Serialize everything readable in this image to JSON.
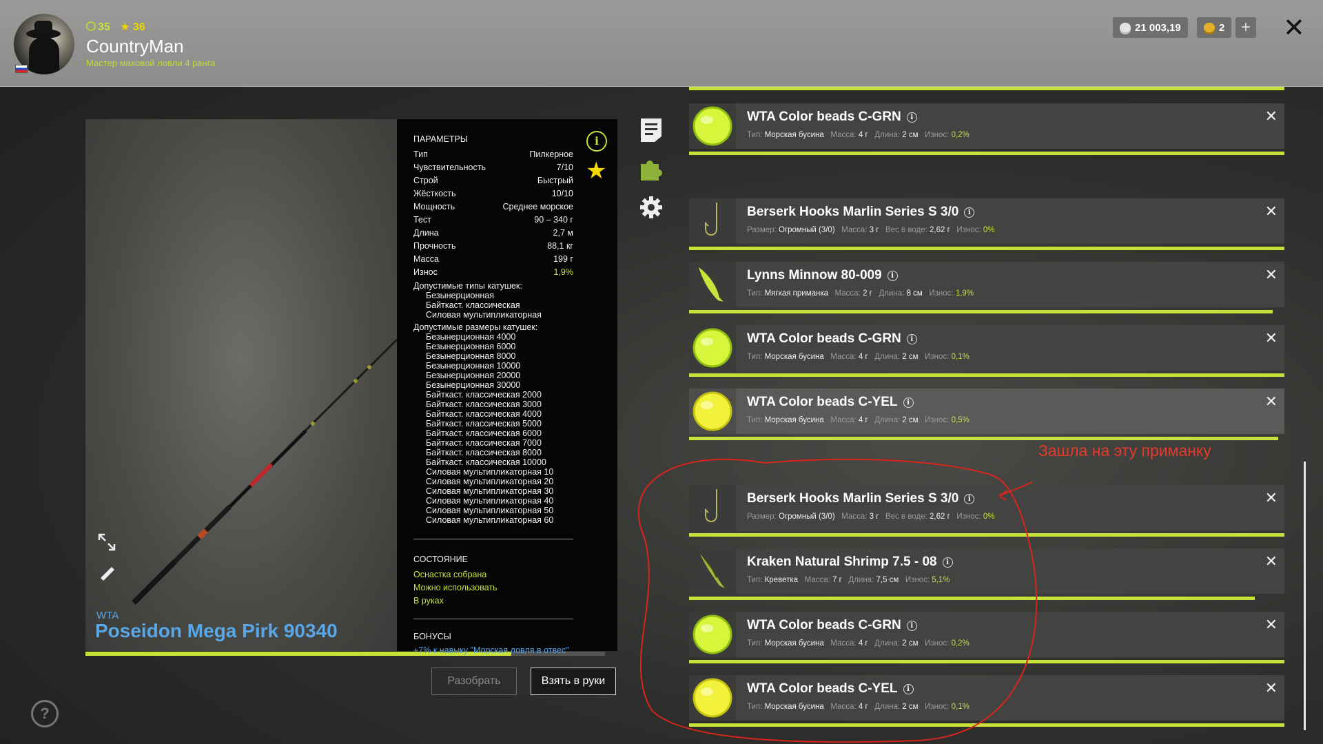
{
  "header": {
    "level": "35",
    "stars": "36",
    "username": "CountryMan",
    "rank": "Мастер маховой ловли 4 ранга",
    "silver": "21 003,19",
    "gold": "2",
    "plus": "+",
    "close": "✕"
  },
  "rod": {
    "brand": "WTA",
    "name": "Poseidon Mega Pirk 90340",
    "wear_progress": 0.82
  },
  "params": {
    "title": "ПАРАМЕТРЫ",
    "rows": [
      {
        "label": "Тип",
        "value": "Пилкерное"
      },
      {
        "label": "Чувствительность",
        "value": "7/10"
      },
      {
        "label": "Строй",
        "value": "Быстрый"
      },
      {
        "label": "Жёсткость",
        "value": "10/10"
      },
      {
        "label": "Мощность",
        "value": "Среднее морское"
      },
      {
        "label": "Тест",
        "value": "90 – 340 г"
      },
      {
        "label": "Длина",
        "value": "2,7 м"
      },
      {
        "label": "Прочность",
        "value": "88,1 кг"
      },
      {
        "label": "Масса",
        "value": "199 г"
      },
      {
        "label": "Износ",
        "value": "1,9%"
      }
    ],
    "reel_types_label": "Допустимые типы катушек:",
    "reel_types": [
      "Безынерционная",
      "Байткаст. классическая",
      "Силовая мультипликаторная"
    ],
    "reel_sizes_label": "Допустимые размеры катушек:",
    "reel_sizes": [
      "Безынерционная 4000",
      "Безынерционная 6000",
      "Безынерционная 8000",
      "Безынерционная 10000",
      "Безынерционная 20000",
      "Безынерционная 30000",
      "Байткаст. классическая 2000",
      "Байткаст. классическая 3000",
      "Байткаст. классическая 4000",
      "Байткаст. классическая 5000",
      "Байткаст. классическая 6000",
      "Байткаст. классическая 7000",
      "Байткаст. классическая 8000",
      "Байткаст. классическая 10000",
      "Силовая мультипликаторная 10",
      "Силовая мультипликаторная 20",
      "Силовая мультипликаторная 30",
      "Силовая мультипликаторная 40",
      "Силовая мультипликаторная 50",
      "Силовая мультипликаторная 60"
    ],
    "state_title": "СОСТОЯНИЕ",
    "state": [
      "Оснастка собрана",
      "Можно использовать",
      "В руках"
    ],
    "bonus_title": "БОНУСЫ",
    "bonus": "+7% к навыку \"Морская ловля в отвес\""
  },
  "buttons": {
    "disassemble": "Разобрать",
    "take": "Взять в руки"
  },
  "help": "?",
  "annotation": "Зашла на эту приманку",
  "items": [
    {
      "name": "WTA Color beads C-GRN",
      "icon": "green-bead",
      "f1l": "Тип:",
      "f1v": "Морская бусина",
      "f2l": "Масса:",
      "f2v": "4 г",
      "f3l": "Длина:",
      "f3v": "2 см",
      "wl": "Износ:",
      "wv": "0,2%",
      "bar": 1.0
    },
    {
      "name": "Berserk Hooks Marlin Series S 3/0",
      "icon": "hook",
      "f1l": "Размер:",
      "f1v": "Огромный (3/0)",
      "f2l": "Масса:",
      "f2v": "3 г",
      "f3l": "Вес в воде:",
      "f3v": "2,62 г",
      "wl": "Износ:",
      "wv": "0%",
      "bar": 1.0
    },
    {
      "name": "Lynns Minnow 80-009",
      "icon": "minnow",
      "f1l": "Тип:",
      "f1v": "Мягкая приманка",
      "f2l": "Масса:",
      "f2v": "2 г",
      "f3l": "Длина:",
      "f3v": "8 см",
      "wl": "Износ:",
      "wv": "1,9%",
      "bar": 0.98
    },
    {
      "name": "WTA Color beads C-GRN",
      "icon": "green-bead",
      "f1l": "Тип:",
      "f1v": "Морская бусина",
      "f2l": "Масса:",
      "f2v": "4 г",
      "f3l": "Длина:",
      "f3v": "2 см",
      "wl": "Износ:",
      "wv": "0,1%",
      "bar": 1.0
    },
    {
      "name": "WTA Color beads C-YEL",
      "icon": "yellow-bead",
      "f1l": "Тип:",
      "f1v": "Морская бусина",
      "f2l": "Масса:",
      "f2v": "4 г",
      "f3l": "Длина:",
      "f3v": "2 см",
      "wl": "Износ:",
      "wv": "0,5%",
      "bar": 0.99
    },
    {
      "name": "Berserk Hooks Marlin Series S 3/0",
      "icon": "hook",
      "f1l": "Размер:",
      "f1v": "Огромный (3/0)",
      "f2l": "Масса:",
      "f2v": "3 г",
      "f3l": "Вес в воде:",
      "f3v": "2,62 г",
      "wl": "Износ:",
      "wv": "0%",
      "bar": 1.0
    },
    {
      "name": "Kraken Natural Shrimp 7.5 - 08",
      "icon": "shrimp",
      "f1l": "Тип:",
      "f1v": "Креветка",
      "f2l": "Масса:",
      "f2v": "7 г",
      "f3l": "Длина:",
      "f3v": "7,5 см",
      "wl": "Износ:",
      "wv": "5,1%",
      "bar": 0.95
    },
    {
      "name": "WTA Color beads C-GRN",
      "icon": "green-bead",
      "f1l": "Тип:",
      "f1v": "Морская бусина",
      "f2l": "Масса:",
      "f2v": "4 г",
      "f3l": "Длина:",
      "f3v": "2 см",
      "wl": "Износ:",
      "wv": "0,2%",
      "bar": 1.0
    },
    {
      "name": "WTA Color beads C-YEL",
      "icon": "yellow-bead",
      "f1l": "Тип:",
      "f1v": "Морская бусина",
      "f2l": "Масса:",
      "f2v": "4 г",
      "f3l": "Длина:",
      "f3v": "2 см",
      "wl": "Износ:",
      "wv": "0,1%",
      "bar": 1.0
    }
  ],
  "colors": {
    "accent": "#c8e03a",
    "blue": "#59a7e6",
    "annotation": "#e53a2a"
  }
}
